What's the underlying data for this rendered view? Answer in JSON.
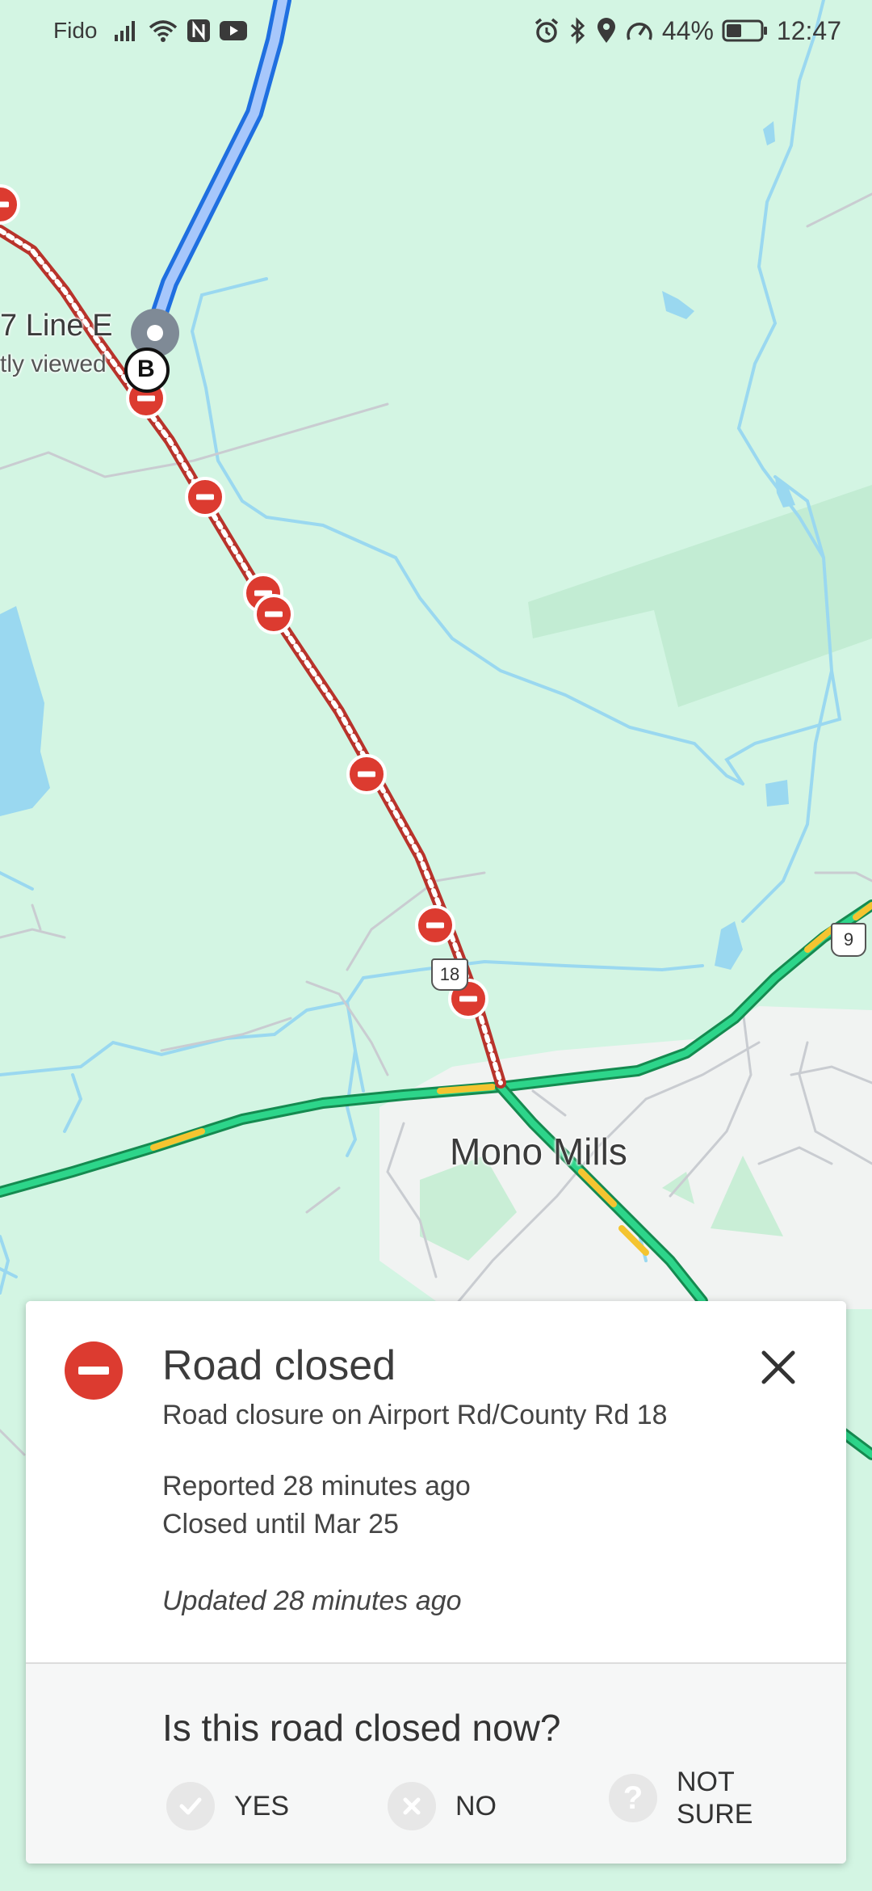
{
  "status_bar": {
    "carrier": "Fido",
    "battery": "44%",
    "time": "12:47",
    "icons": [
      "signal-icon",
      "wifi-icon",
      "nfc-icon",
      "youtube-icon",
      "alarm-icon",
      "bluetooth-icon",
      "location-icon",
      "speed-icon",
      "battery-icon"
    ]
  },
  "map": {
    "place_label_partial": "7 Line E",
    "place_sublabel_partial": "tly viewed",
    "waypoint": "B",
    "town": "Mono Mills",
    "route_shield_18": "18",
    "route_shield_9": "9",
    "colors": {
      "land": "#d3f5e3",
      "water": "#9ad8f0",
      "route_blue": "#1f6fe0",
      "highway_green": "#1fa463",
      "closure_red": "#dc3b30",
      "town_area": "#f2f3f3"
    }
  },
  "card": {
    "title": "Road closed",
    "description": "Road closure on Airport Rd/County Rd 18",
    "reported": "Reported 28 minutes ago",
    "closed_until": "Closed until Mar 25",
    "updated": "Updated 28 minutes ago",
    "question": "Is this road closed now?",
    "options": {
      "yes": "YES",
      "no": "NO",
      "not_sure": "NOT SURE"
    }
  }
}
